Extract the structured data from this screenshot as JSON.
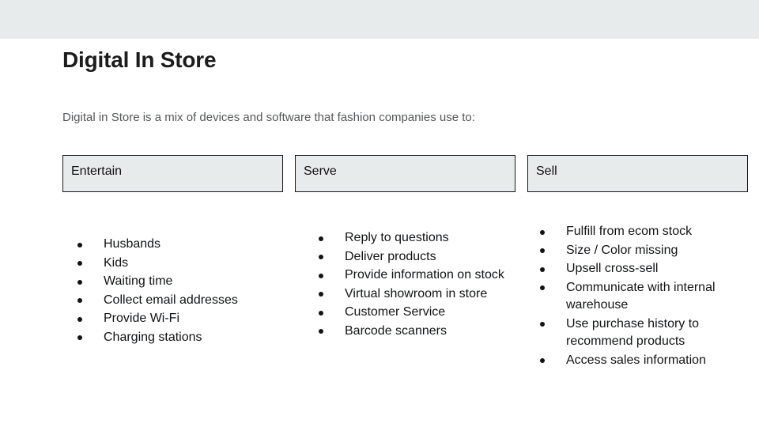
{
  "top_bar": {
    "color": "#e8ebec"
  },
  "slide": {
    "title": "Digital In Store",
    "subtitle": "Digital in Store is a mix of devices and software that fashion companies use to:",
    "background_color": "#ffffff",
    "text_color": "#111315",
    "box_fill_color": "#e8ebec",
    "box_border_color": "#15181a",
    "columns": [
      {
        "header": "Entertain",
        "items": [
          "Husbands",
          "Kids",
          "Waiting time",
          "Collect email addresses",
          "Provide Wi-Fi",
          "Charging stations"
        ]
      },
      {
        "header": "Serve",
        "items": [
          "Reply to questions",
          "Deliver products",
          "Provide information on stock",
          "Virtual showroom in store",
          "Customer Service",
          "Barcode scanners"
        ]
      },
      {
        "header": "Sell",
        "items": [
          "Fulfill from ecom stock",
          "Size / Color missing",
          "Upsell cross-sell",
          "Communicate with internal warehouse",
          "Use purchase history to recommend products",
          "Access sales information"
        ]
      }
    ]
  }
}
